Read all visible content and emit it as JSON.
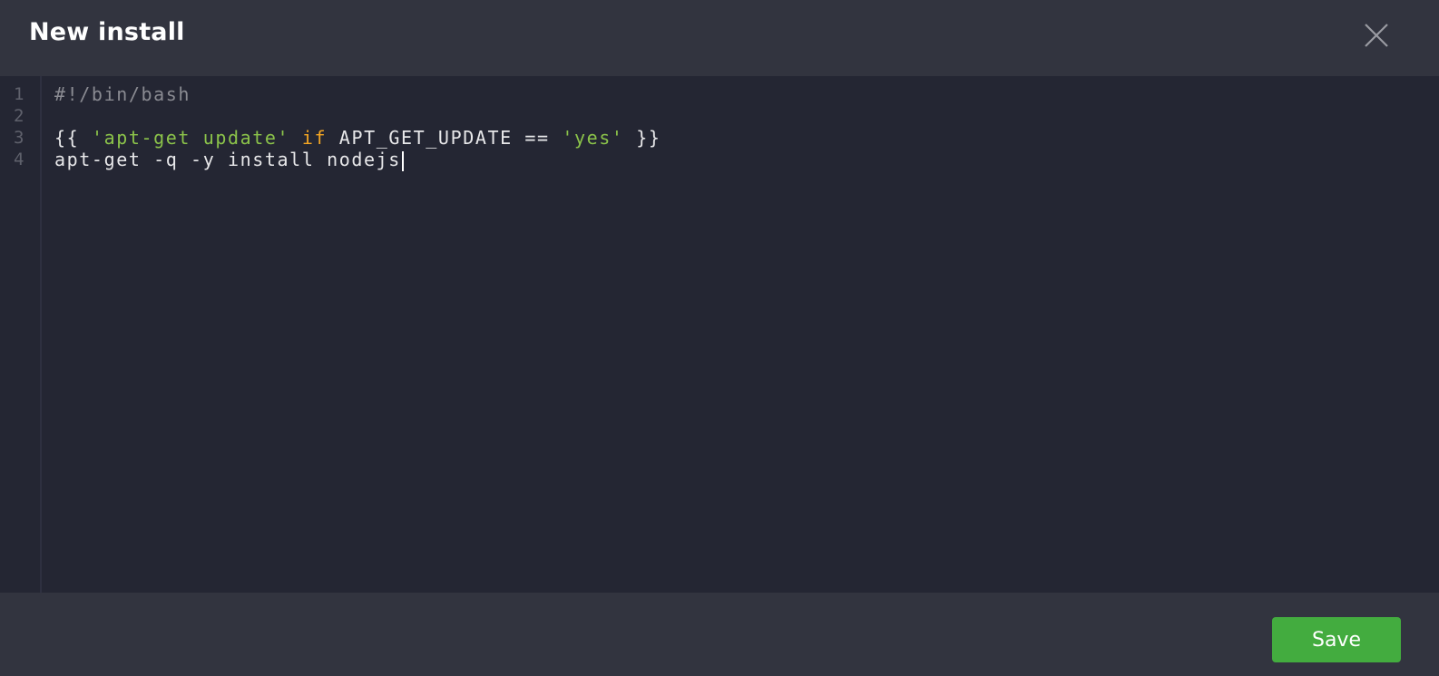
{
  "modal": {
    "title": "New install",
    "close_icon": "close-icon"
  },
  "editor": {
    "language": "bash",
    "line_numbers": [
      "1",
      "2",
      "3",
      "4"
    ],
    "lines": [
      [
        {
          "type": "comment",
          "text": "#!/bin/bash"
        }
      ],
      [],
      [
        {
          "type": "plain",
          "text": "{{ "
        },
        {
          "type": "string",
          "text": "'apt-get update'"
        },
        {
          "type": "plain",
          "text": " "
        },
        {
          "type": "keyword",
          "text": "if"
        },
        {
          "type": "plain",
          "text": " APT_GET_UPDATE == "
        },
        {
          "type": "string",
          "text": "'yes'"
        },
        {
          "type": "plain",
          "text": " }}"
        }
      ],
      [
        {
          "type": "plain",
          "text": "apt-get -q -y install nodejs"
        }
      ]
    ],
    "cursor": {
      "line": 4,
      "after_text": "apt-get -q -y install nodejs"
    }
  },
  "footer": {
    "save_label": "Save"
  },
  "colors": {
    "save_button": "#43ac3f",
    "string": "#8bc34a",
    "keyword": "#f5a623",
    "comment": "#8a8b92",
    "header_bg": "#32343f",
    "editor_bg": "#242633"
  }
}
